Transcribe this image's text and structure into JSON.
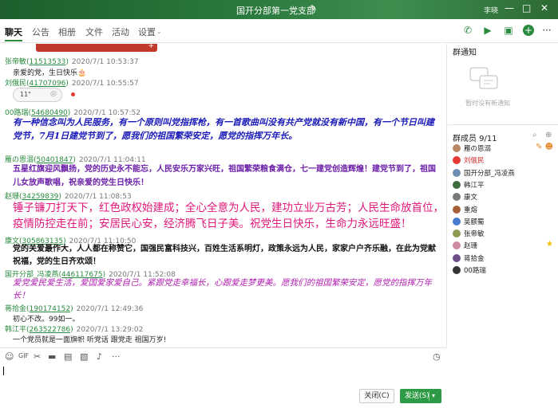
{
  "window": {
    "title": "国开分部第一党支部",
    "edit_icon": "pencil-icon",
    "user": "李晓",
    "controls": [
      "—",
      "□",
      "✕"
    ]
  },
  "tabs": [
    "聊天",
    "公告",
    "相册",
    "文件",
    "活动",
    "设置"
  ],
  "toolbar_icons": [
    "phone-icon",
    "video-icon",
    "screen-share-icon",
    "add-icon",
    "more-icon"
  ],
  "messages": [
    {
      "sender": "张帝敏",
      "id": "11513533",
      "time": "2020/7/1 10:53:37",
      "text": "亲爱的党，生日快乐🎂"
    },
    {
      "sender": "刘俄民",
      "id": "41707096",
      "time": "2020/7/1 10:55:57",
      "voice": "11\""
    },
    {
      "sender": "00路瑞",
      "id": "54680490",
      "time": "2020/7/1 10:57:52",
      "text": "有一种信念叫为人民服务，有一个原则叫党指挥枪，有一首歌曲叫没有共产党就没有新中国，有一个节日叫建党节，7月1日建党节到了，愿我们的祖国繁荣安定，愿党的指挥万年长。"
    },
    {
      "sender": "雁の恩溺",
      "id": "50401847",
      "time": "2020/7/1 11:04:11",
      "text": "五星红旗迎风飘扬，党的历史永不能忘，人民安乐万家兴旺，祖国繁荣粮食满仓，七一建党创造辉煌！建党节到了，祖国儿女放声歌唱，祝亲爱的党生日快乐！"
    },
    {
      "sender": "赵珊",
      "id": "34259839",
      "time": "2020/7/1 11:08:53",
      "text": "锤子镰刀打天下，红色政权始建成；全心全意为人民，建功立业万古芳；人民生命放首位，疫情防控走在前；安居民心安，经济腾飞日子美。祝党生日快乐，生命力永远旺盛！"
    },
    {
      "sender": "康文",
      "id": "305863135",
      "time": "2020/7/1 11:10:50",
      "text": "党的关爱最作大，人人都在称赞它，国强民富科技兴，百姓生活系明灯，政策永远为人民，家家户户齐乐融，在此为党献祝福，党的生日齐欢颂！"
    },
    {
      "sender": "国开分部_冯凌燕",
      "id": "446117675",
      "time": "2020/7/1 11:52:08",
      "text": "爱党爱民爱生活，爱国爱家爱自己。紧跟党走幸福长，心跟爱走梦更美。愿我们的祖国繁荣安定，愿党的指挥万年长！"
    },
    {
      "sender": "蒋拾金",
      "id": "190174152",
      "time": "2020/7/1 12:49:36",
      "text": "初心不改。99如一。"
    },
    {
      "sender": "韩江平",
      "id": "263522786",
      "time": "2020/7/1 13:29:02",
      "text": "一个党员就是一面旗帜 听党话 跟党走 祖国万岁!"
    }
  ],
  "input_toolbar_icons": [
    "emoji-icon",
    "gif-icon",
    "scissors-icon",
    "folder-icon",
    "image-icon",
    "screenshot-icon",
    "bell-icon",
    "more-icon",
    "history-icon"
  ],
  "buttons": {
    "close": "关闭(C)",
    "send": "发送(S)"
  },
  "sidebar": {
    "notice_title": "群通知",
    "notice_empty": "暂时没有新通知",
    "members_title": "群成员 9/11",
    "members": [
      {
        "name": "雁の恩溺",
        "color": "#b9896a",
        "highlight": false
      },
      {
        "name": "刘俄民",
        "color": "#e53935",
        "highlight": true
      },
      {
        "name": "国开分部_冯凌燕",
        "color": "#6d8fb3",
        "highlight": false
      },
      {
        "name": "韩江平",
        "color": "#3d6b3f",
        "highlight": false
      },
      {
        "name": "康文",
        "color": "#7a7a7a",
        "highlight": false
      },
      {
        "name": "重熔",
        "color": "#a85f3a",
        "highlight": false
      },
      {
        "name": "吴额蜀",
        "color": "#4a7bd0",
        "highlight": false
      },
      {
        "name": "张帝敏",
        "color": "#8e9a4e",
        "highlight": false
      },
      {
        "name": "赵珊",
        "color": "#d08aa0",
        "highlight": false
      },
      {
        "name": "蒋拾金",
        "color": "#6e4d8b",
        "highlight": false
      },
      {
        "name": "00路瑞",
        "color": "#333333",
        "highlight": false
      }
    ]
  }
}
